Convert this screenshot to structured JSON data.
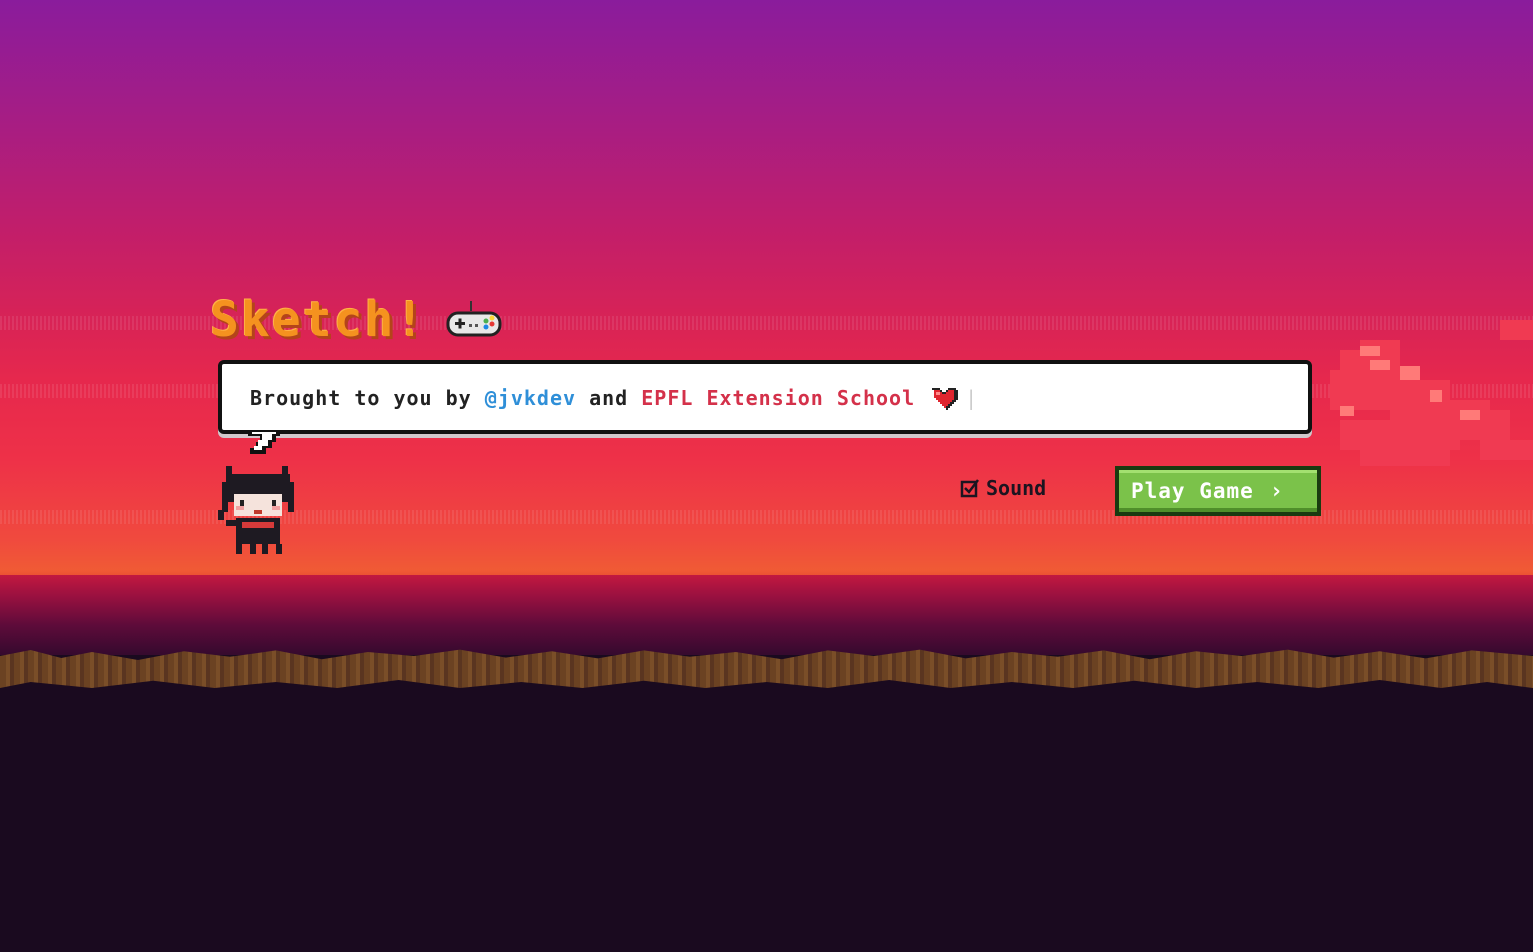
{
  "title": "Sketch!",
  "banner": {
    "prefix": "Brought to you by ",
    "author": "@jvkdev",
    "middle": " and ",
    "org": "EPFL Extension School"
  },
  "sound": {
    "label": "Sound",
    "checked": true
  },
  "play_button": {
    "label": "Play Game",
    "chevron": "›"
  },
  "icons": {
    "controller": "controller-icon",
    "heart": "heart-icon",
    "checkbox": "checkbox-checked-icon",
    "chevron": "chevron-right-icon"
  },
  "colors": {
    "title": "#f5921f",
    "author_link": "#2f8fd8",
    "org_link": "#d4314a",
    "play_button": "#7bc24a"
  }
}
